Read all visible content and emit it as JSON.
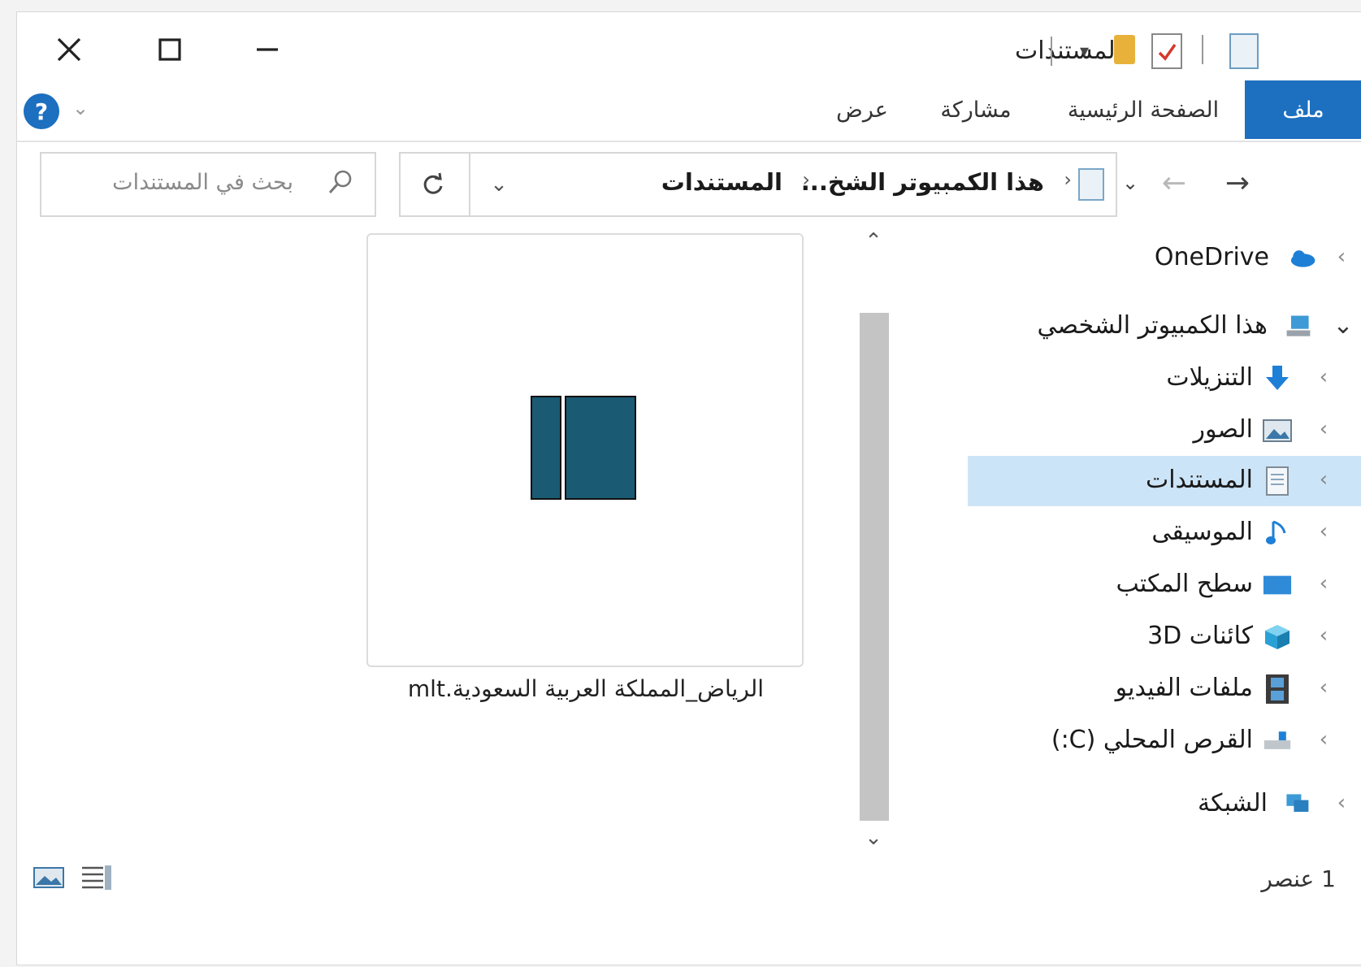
{
  "window": {
    "title": "المستندات",
    "close_icon": "close-icon",
    "maximize_icon": "maximize-icon",
    "minimize_icon": "minimize-icon"
  },
  "ribbon": {
    "tabs": [
      {
        "label": "ملف",
        "active": true
      },
      {
        "label": "الصفحة الرئيسية",
        "active": false
      },
      {
        "label": "مشاركة",
        "active": false
      },
      {
        "label": "عرض",
        "active": false
      }
    ],
    "help_icon": "help-icon"
  },
  "address_bar": {
    "path": [
      "هذا الكمبيوتر الشخ...",
      "المستندات"
    ],
    "refresh_icon": "refresh-icon",
    "dropdown_icon": "chevron-down-icon"
  },
  "search": {
    "placeholder": "بحث في المستندات"
  },
  "navigation": {
    "items": [
      {
        "label": "OneDrive",
        "icon": "cloud-icon",
        "level": 0
      },
      {
        "label": "هذا الكمبيوتر الشخصي",
        "icon": "computer-icon",
        "level": 0,
        "expanded": true
      },
      {
        "label": "التنزيلات",
        "icon": "download-icon",
        "level": 1
      },
      {
        "label": "الصور",
        "icon": "pictures-icon",
        "level": 1
      },
      {
        "label": "المستندات",
        "icon": "documents-icon",
        "level": 1,
        "selected": true
      },
      {
        "label": "الموسيقى",
        "icon": "music-icon",
        "level": 1
      },
      {
        "label": "سطح المكتب",
        "icon": "desktop-icon",
        "level": 1
      },
      {
        "label": "كائنات 3D",
        "icon": "3d-objects-icon",
        "level": 1
      },
      {
        "label": "ملفات الفيديو",
        "icon": "video-icon",
        "level": 1
      },
      {
        "label": "القرص المحلي (C:)",
        "icon": "drive-icon",
        "level": 1
      },
      {
        "label": "الشبكة",
        "icon": "network-icon",
        "level": 0
      }
    ]
  },
  "files": [
    {
      "name": "الرياض_المملكة العربية السعودية.mlt",
      "icon": "mlt-file-icon"
    }
  ],
  "status_bar": {
    "item_count": "1 عنصر"
  },
  "colors": {
    "accent": "#1d6fbf",
    "selection": "#cce4f7",
    "file_icon": "#1b5a73"
  }
}
